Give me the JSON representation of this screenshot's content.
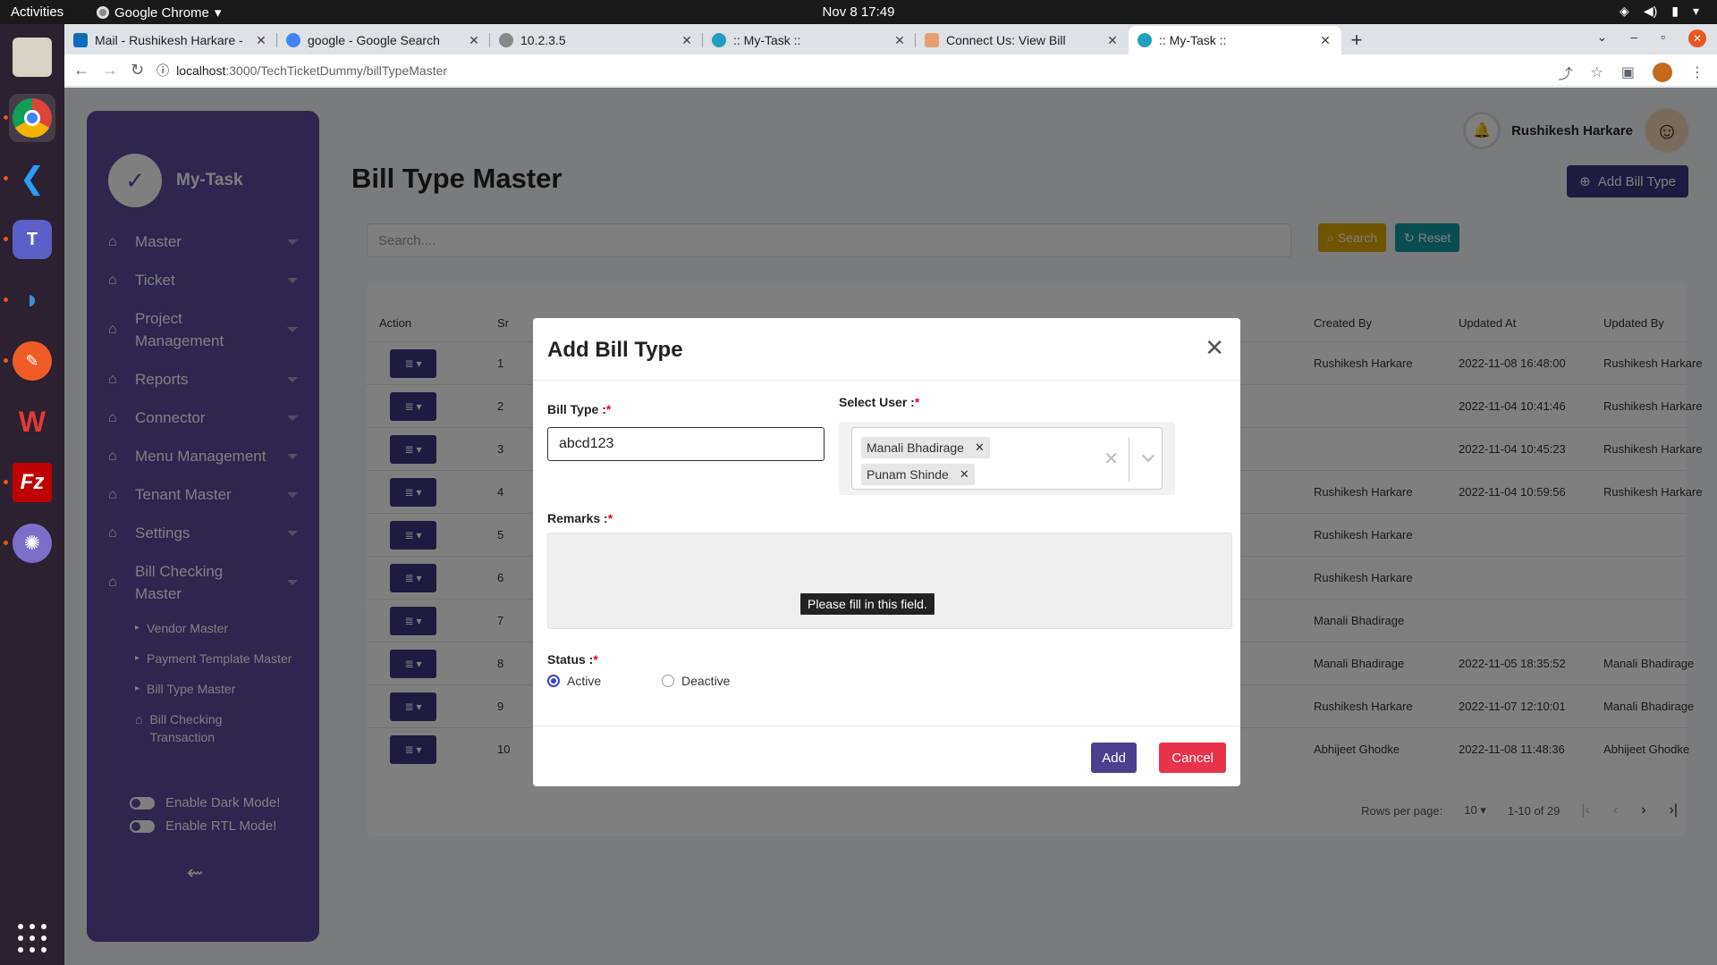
{
  "system": {
    "activities": "Activities",
    "app_menu": "Google Chrome",
    "clock": "Nov 8  17:49"
  },
  "browser": {
    "tabs": [
      {
        "title": "Mail - Rushikesh Harkare -",
        "favicon_color": "#0f6cbd"
      },
      {
        "title": "google - Google Search",
        "favicon_color": "#4285f4"
      },
      {
        "title": "10.2.3.5",
        "favicon_color": "#888888"
      },
      {
        "title": ":: My-Task ::",
        "favicon_color": "#20a0c0"
      },
      {
        "title": "Connect Us: View Bill",
        "favicon_color": "#e8a070"
      },
      {
        "title": ":: My-Task ::",
        "favicon_color": "#20a0c0"
      }
    ],
    "address_host": "localhost",
    "address_path": ":3000/TechTicketDummy/billTypeMaster"
  },
  "sidebar": {
    "brand": "My-Task",
    "items": [
      {
        "label": "Master"
      },
      {
        "label": "Ticket"
      },
      {
        "label": "Project Management"
      },
      {
        "label": "Reports"
      },
      {
        "label": "Connector"
      },
      {
        "label": "Menu Management"
      },
      {
        "label": "Tenant Master"
      },
      {
        "label": "Settings"
      },
      {
        "label": "Bill Checking Master"
      }
    ],
    "subitems": [
      {
        "label": "Vendor Master"
      },
      {
        "label": "Payment Template Master"
      },
      {
        "label": "Bill Type Master"
      },
      {
        "label": "Bill Checking Transaction"
      }
    ],
    "dark_mode": "Enable Dark Mode!",
    "rtl_mode": "Enable RTL Mode!"
  },
  "header": {
    "user_name": "Rushikesh Harkare",
    "page_title": "Bill Type Master",
    "add_button": "Add Bill Type",
    "search_placeholder": "Search....",
    "search_button": "Search",
    "reset_button": "Reset"
  },
  "table": {
    "headers": {
      "action": "Action",
      "sr": "Sr",
      "created_by": "Created By",
      "updated_at": "Updated At",
      "updated_by": "Updated By"
    },
    "rows": [
      {
        "sr": "1",
        "created_by": "Rushikesh Harkare",
        "updated_at": "2022-11-08 16:48:00",
        "updated_by": "Rushikesh Harkare"
      },
      {
        "sr": "2",
        "created_by": "",
        "updated_at": "2022-11-04 10:41:46",
        "updated_by": "Rushikesh Harkare"
      },
      {
        "sr": "3",
        "created_by": "",
        "updated_at": "2022-11-04 10:45:23",
        "updated_by": "Rushikesh Harkare"
      },
      {
        "sr": "4",
        "created_by": "Rushikesh Harkare",
        "updated_at": "2022-11-04 10:59:56",
        "updated_by": "Rushikesh Harkare"
      },
      {
        "sr": "5",
        "created_by": "Rushikesh Harkare",
        "updated_at": "",
        "updated_by": ""
      },
      {
        "sr": "6",
        "created_by": "Rushikesh Harkare",
        "updated_at": "",
        "updated_by": ""
      },
      {
        "sr": "7",
        "created_by": "Manali Bhadirage",
        "updated_at": "",
        "updated_by": ""
      },
      {
        "sr": "8",
        "created_by": "Manali Bhadirage",
        "updated_at": "2022-11-05 18:35:52",
        "updated_by": "Manali Bhadirage"
      },
      {
        "sr": "9",
        "created_by": "Rushikesh Harkare",
        "updated_at": "2022-11-07 12:10:01",
        "updated_by": "Manali Bhadirage"
      },
      {
        "sr": "10",
        "created_by": "Abhijeet Ghodke",
        "updated_at": "2022-11-08 11:48:36",
        "updated_by": "Abhijeet Ghodke"
      }
    ],
    "rows_per_page_label": "Rows per page:",
    "rows_per_page_value": "10",
    "range": "1-10 of 29"
  },
  "modal": {
    "title": "Add Bill Type",
    "bill_type_label": "Bill Type :",
    "bill_type_value": "abcd123",
    "select_user_label": "Select User :",
    "selected_users": [
      "Manali Bhadirage",
      "Punam Shinde"
    ],
    "remarks_label": "Remarks :",
    "tooltip": "Please fill in this field.",
    "status_label": "Status :",
    "status_active": "Active",
    "status_deactive": "Deactive",
    "add_button": "Add",
    "cancel_button": "Cancel",
    "required_mark": "*"
  },
  "colors": {
    "sidebar_bg": "#5c4d9c",
    "primary": "#3d3580",
    "search_btn": "#e0a800",
    "reset_btn": "#159aa0",
    "cancel_btn": "#e8334a"
  }
}
